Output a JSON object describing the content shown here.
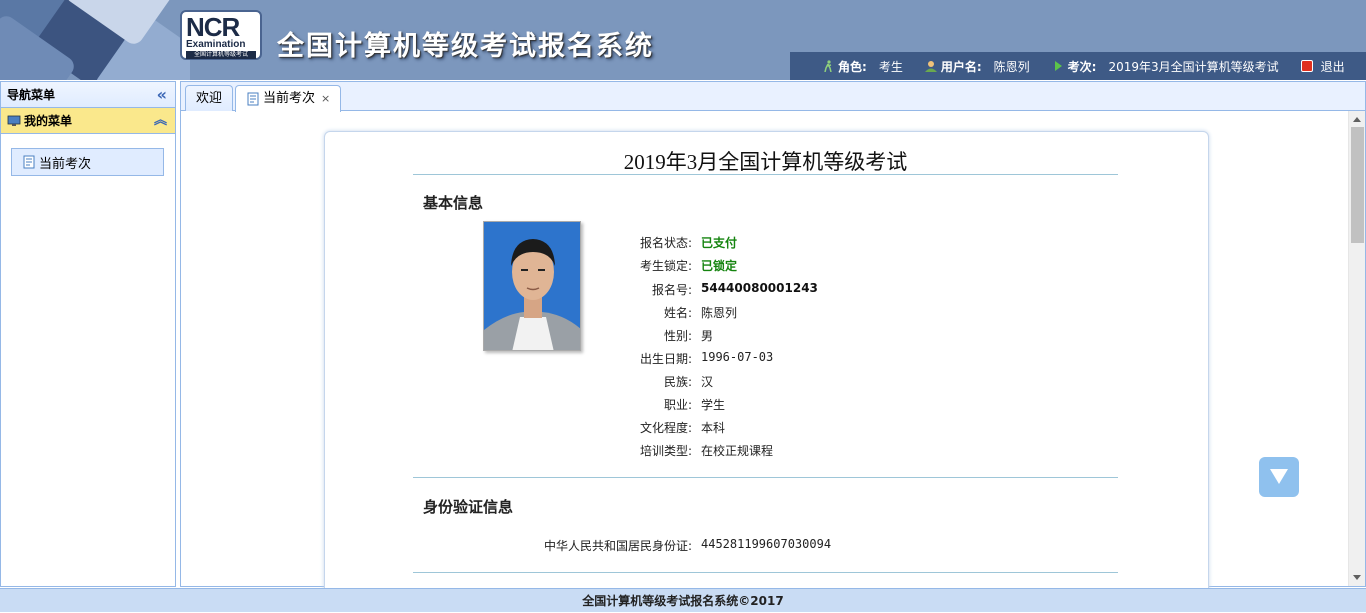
{
  "header": {
    "logo_text": "NCR",
    "logo_sub": "Examination",
    "logo_tiny": "全国计算机等级考试",
    "system_title": "全国计算机等级考试报名系统",
    "role_label": "角色:",
    "role_value": "考生",
    "user_label": "用户名:",
    "user_value": "陈恩列",
    "exam_label": "考次:",
    "exam_value": "2019年3月全国计算机等级考试",
    "logout_label": "退出"
  },
  "sidebar": {
    "title": "导航菜单",
    "section_title": "我的菜单",
    "items": [
      {
        "label": "当前考次"
      }
    ]
  },
  "tabs": [
    {
      "label": "欢迎"
    },
    {
      "label": "当前考次",
      "close": "×"
    }
  ],
  "content": {
    "exam_title": "2019年3月全国计算机等级考试",
    "basic_title": "基本信息",
    "fields": [
      {
        "key": "报名状态:",
        "value": "已支付"
      },
      {
        "key": "考生锁定:",
        "value": "已锁定"
      },
      {
        "key": "报名号:",
        "value": "54440080001243"
      },
      {
        "key": "姓名:",
        "value": "陈恩列"
      },
      {
        "key": "性别:",
        "value": "男"
      },
      {
        "key": "出生日期:",
        "value": "1996-07-03"
      },
      {
        "key": "民族:",
        "value": "汉"
      },
      {
        "key": "职业:",
        "value": "学生"
      },
      {
        "key": "文化程度:",
        "value": "本科"
      },
      {
        "key": "培训类型:",
        "value": "在校正规课程"
      }
    ],
    "id_title": "身份验证信息",
    "id_fields": [
      {
        "key": "中华人民共和国居民身份证:",
        "value": "445281199607030094"
      }
    ]
  },
  "footer": {
    "text": "全国计算机等级考试报名系统©2017"
  },
  "colors": {
    "header_bg": "#7c97bd",
    "infobar_bg": "#3e5a86",
    "accent_green": "#15840f",
    "panel_border": "#95b8e7"
  }
}
